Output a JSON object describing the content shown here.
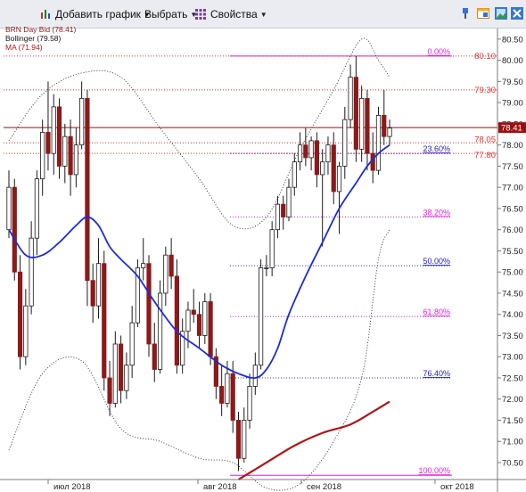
{
  "toolbar": {
    "add_chart": "Добавить график",
    "select": "Выбрать",
    "properties": "Свойства"
  },
  "legend": {
    "main": "BRN Day Bid (78.41)",
    "bollinger": "Bollinger (79.58)",
    "ma": "MA (71.94)"
  },
  "colors": {
    "up": "#ffffff",
    "down": "#8b1a1a",
    "ma_fast": "#1c2bd9",
    "ma_slow": "#b01515",
    "fib": "#e020e0",
    "bollinger": "#222222"
  },
  "chart_data": {
    "type": "candlestick",
    "instrument": "BRN Day Bid",
    "ylim": [
      70.1,
      80.75
    ],
    "y_ticks": [
      70.5,
      71.0,
      71.5,
      72.0,
      72.5,
      73.0,
      73.5,
      74.0,
      74.5,
      75.0,
      75.5,
      76.0,
      76.5,
      77.0,
      77.5,
      78.0,
      78.5,
      79.0,
      79.5,
      80.0,
      80.5
    ],
    "x_labels": [
      "июл 2018",
      "авг 2018",
      "сен 2018",
      "окт 2018"
    ],
    "last_price": 78.41,
    "price_tags": [
      80.1,
      79.3,
      78.05,
      77.8
    ],
    "candles": [
      [
        76.0,
        77.4,
        75.8,
        77.0
      ],
      [
        77.0,
        77.2,
        74.8,
        75.0
      ],
      [
        75.0,
        75.4,
        72.7,
        73.0
      ],
      [
        73.0,
        74.6,
        72.8,
        74.2
      ],
      [
        74.2,
        76.2,
        74.0,
        75.8
      ],
      [
        75.8,
        77.4,
        75.4,
        77.2
      ],
      [
        77.2,
        78.6,
        76.8,
        78.3
      ],
      [
        78.3,
        79.5,
        77.4,
        77.8
      ],
      [
        77.8,
        79.2,
        77.3,
        78.9
      ],
      [
        78.9,
        79.1,
        77.2,
        77.5
      ],
      [
        77.5,
        78.5,
        77.1,
        78.2
      ],
      [
        78.2,
        78.6,
        76.8,
        77.3
      ],
      [
        77.3,
        78.4,
        77.0,
        78.0
      ],
      [
        78.0,
        79.5,
        77.9,
        79.1
      ],
      [
        79.1,
        79.3,
        74.2,
        74.8
      ],
      [
        74.8,
        75.2,
        73.8,
        74.2
      ],
      [
        74.2,
        75.8,
        73.9,
        75.2
      ],
      [
        75.2,
        75.5,
        72.2,
        72.5
      ],
      [
        72.5,
        72.9,
        71.6,
        71.9
      ],
      [
        71.9,
        73.6,
        71.8,
        73.3
      ],
      [
        73.3,
        73.5,
        71.9,
        72.2
      ],
      [
        72.2,
        73.1,
        72.0,
        72.8
      ],
      [
        72.8,
        74.2,
        72.5,
        73.8
      ],
      [
        73.8,
        75.3,
        73.7,
        75.1
      ],
      [
        75.1,
        75.8,
        74.8,
        75.2
      ],
      [
        75.2,
        75.4,
        73.0,
        73.3
      ],
      [
        73.3,
        73.8,
        72.4,
        72.7
      ],
      [
        72.7,
        74.8,
        72.6,
        74.5
      ],
      [
        74.5,
        75.6,
        74.2,
        75.4
      ],
      [
        75.4,
        75.8,
        74.6,
        74.9
      ],
      [
        74.9,
        75.3,
        72.6,
        72.8
      ],
      [
        72.8,
        73.9,
        72.6,
        73.6
      ],
      [
        73.6,
        74.3,
        73.2,
        74.1
      ],
      [
        74.1,
        74.6,
        73.8,
        74.0
      ],
      [
        74.0,
        74.3,
        73.2,
        73.5
      ],
      [
        73.5,
        74.5,
        73.3,
        74.3
      ],
      [
        74.3,
        74.5,
        72.8,
        73.0
      ],
      [
        73.0,
        73.2,
        72.0,
        72.3
      ],
      [
        72.3,
        72.8,
        71.6,
        71.9
      ],
      [
        71.9,
        72.9,
        71.8,
        72.6
      ],
      [
        72.6,
        72.9,
        71.2,
        71.5
      ],
      [
        71.5,
        71.7,
        70.3,
        70.6
      ],
      [
        70.6,
        71.8,
        70.5,
        71.5
      ],
      [
        71.5,
        72.6,
        71.3,
        72.3
      ],
      [
        72.3,
        73.1,
        72.1,
        72.8
      ],
      [
        72.8,
        75.3,
        72.7,
        75.1
      ],
      [
        75.1,
        75.4,
        74.9,
        75.1
      ],
      [
        75.1,
        76.2,
        74.9,
        76.0
      ],
      [
        76.0,
        76.8,
        75.8,
        76.6
      ],
      [
        76.6,
        76.8,
        76.0,
        76.3
      ],
      [
        76.3,
        77.2,
        76.2,
        77.0
      ],
      [
        77.0,
        77.8,
        76.8,
        77.6
      ],
      [
        77.6,
        78.3,
        77.4,
        78.0
      ],
      [
        78.0,
        78.4,
        77.5,
        77.7
      ],
      [
        77.7,
        78.2,
        77.4,
        78.1
      ],
      [
        78.1,
        78.3,
        77.0,
        77.3
      ],
      [
        77.3,
        77.9,
        75.6,
        77.6
      ],
      [
        77.6,
        78.2,
        77.3,
        78.0
      ],
      [
        78.0,
        78.3,
        76.6,
        76.9
      ],
      [
        76.9,
        77.6,
        75.9,
        77.5
      ],
      [
        77.5,
        78.9,
        77.2,
        78.6
      ],
      [
        78.6,
        79.9,
        78.4,
        79.6
      ],
      [
        79.6,
        80.1,
        77.6,
        77.9
      ],
      [
        77.9,
        79.4,
        77.6,
        79.1
      ],
      [
        79.1,
        79.3,
        77.4,
        77.8
      ],
      [
        77.8,
        78.3,
        77.1,
        77.4
      ],
      [
        77.4,
        78.9,
        77.3,
        78.7
      ],
      [
        78.7,
        79.3,
        78.0,
        78.2
      ],
      [
        78.2,
        78.6,
        78.0,
        78.4
      ]
    ],
    "bollinger_upper": [
      [
        0,
        78.1
      ],
      [
        6,
        79.2
      ],
      [
        13,
        79.7
      ],
      [
        20,
        79.6
      ],
      [
        27,
        78.4
      ],
      [
        34,
        77.2
      ],
      [
        40,
        76.1
      ],
      [
        46,
        76.3
      ],
      [
        52,
        77.9
      ],
      [
        58,
        79.3
      ],
      [
        63,
        80.5
      ],
      [
        66,
        80.0
      ],
      [
        68,
        79.6
      ]
    ],
    "bollinger_lower": [
      [
        0,
        70.8
      ],
      [
        6,
        72.6
      ],
      [
        13,
        72.9
      ],
      [
        20,
        71.3
      ],
      [
        27,
        71.0
      ],
      [
        34,
        70.6
      ],
      [
        40,
        70.5
      ],
      [
        46,
        69.9
      ],
      [
        52,
        70.0
      ],
      [
        58,
        71.0
      ],
      [
        63,
        72.5
      ],
      [
        66,
        75.3
      ],
      [
        68,
        76.0
      ]
    ],
    "series": [
      {
        "name": "MA",
        "values": [
          [
            0,
            76.0
          ],
          [
            3,
            75.4
          ],
          [
            6,
            75.4
          ],
          [
            9,
            75.7
          ],
          [
            12,
            76.1
          ],
          [
            14,
            76.3
          ],
          [
            16,
            76.1
          ],
          [
            18,
            75.6
          ],
          [
            20,
            75.3
          ],
          [
            23,
            74.9
          ],
          [
            26,
            74.3
          ],
          [
            30,
            73.6
          ],
          [
            34,
            73.2
          ],
          [
            38,
            72.8
          ],
          [
            41,
            72.6
          ],
          [
            44,
            72.5
          ],
          [
            46,
            72.7
          ],
          [
            48,
            73.2
          ],
          [
            50,
            74.0
          ],
          [
            53,
            74.9
          ],
          [
            56,
            75.7
          ],
          [
            59,
            76.5
          ],
          [
            62,
            77.1
          ],
          [
            64,
            77.5
          ],
          [
            66,
            77.8
          ],
          [
            68,
            78.0
          ]
        ]
      },
      {
        "name": "MA (71.94)",
        "values": [
          [
            41,
            70.1
          ],
          [
            46,
            70.5
          ],
          [
            51,
            70.9
          ],
          [
            56,
            71.2
          ],
          [
            61,
            71.4
          ],
          [
            65,
            71.7
          ],
          [
            68,
            71.94
          ]
        ]
      }
    ],
    "fibonacci": [
      {
        "label": "0.00%",
        "value": 80.1
      },
      {
        "label": "23.60%",
        "value": 77.8
      },
      {
        "label": "38.20%",
        "value": 76.3
      },
      {
        "label": "50.00%",
        "value": 75.15
      },
      {
        "label": "61.80%",
        "value": 73.95
      },
      {
        "label": "76.40%",
        "value": 72.5
      },
      {
        "label": "100.00%",
        "value": 70.2
      }
    ],
    "red_lines": [
      80.1,
      79.3,
      78.05,
      77.8
    ]
  }
}
